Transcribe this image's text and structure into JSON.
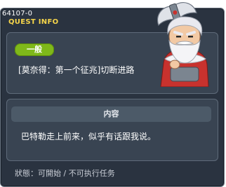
{
  "window": {
    "quest_id": "64107-0",
    "title": "QUEST INFO"
  },
  "quest": {
    "category": "一般",
    "name": "[莫奈得：第一个征兆]切断进路"
  },
  "content": {
    "header": "内容",
    "description": "巴特勒走上前来，似乎有话跟我说。"
  },
  "status": {
    "text": "狀態：可開始 / 不可执行任务"
  },
  "npc": {
    "icon": "npc-old-warrior-portrait",
    "colors": {
      "hair": "#e9e9ef",
      "skin": "#f2c9a4",
      "coat": "#c8322e",
      "armor": "#7b8590",
      "axe_blade": "#dfe2e8",
      "handle": "#9a6a3a"
    }
  },
  "colors": {
    "window_bg": "#2a3340",
    "panel_bg": "#394452",
    "title": "#f7d64a",
    "badge": "#7fb81a",
    "header_bg": "#4c5a68"
  }
}
